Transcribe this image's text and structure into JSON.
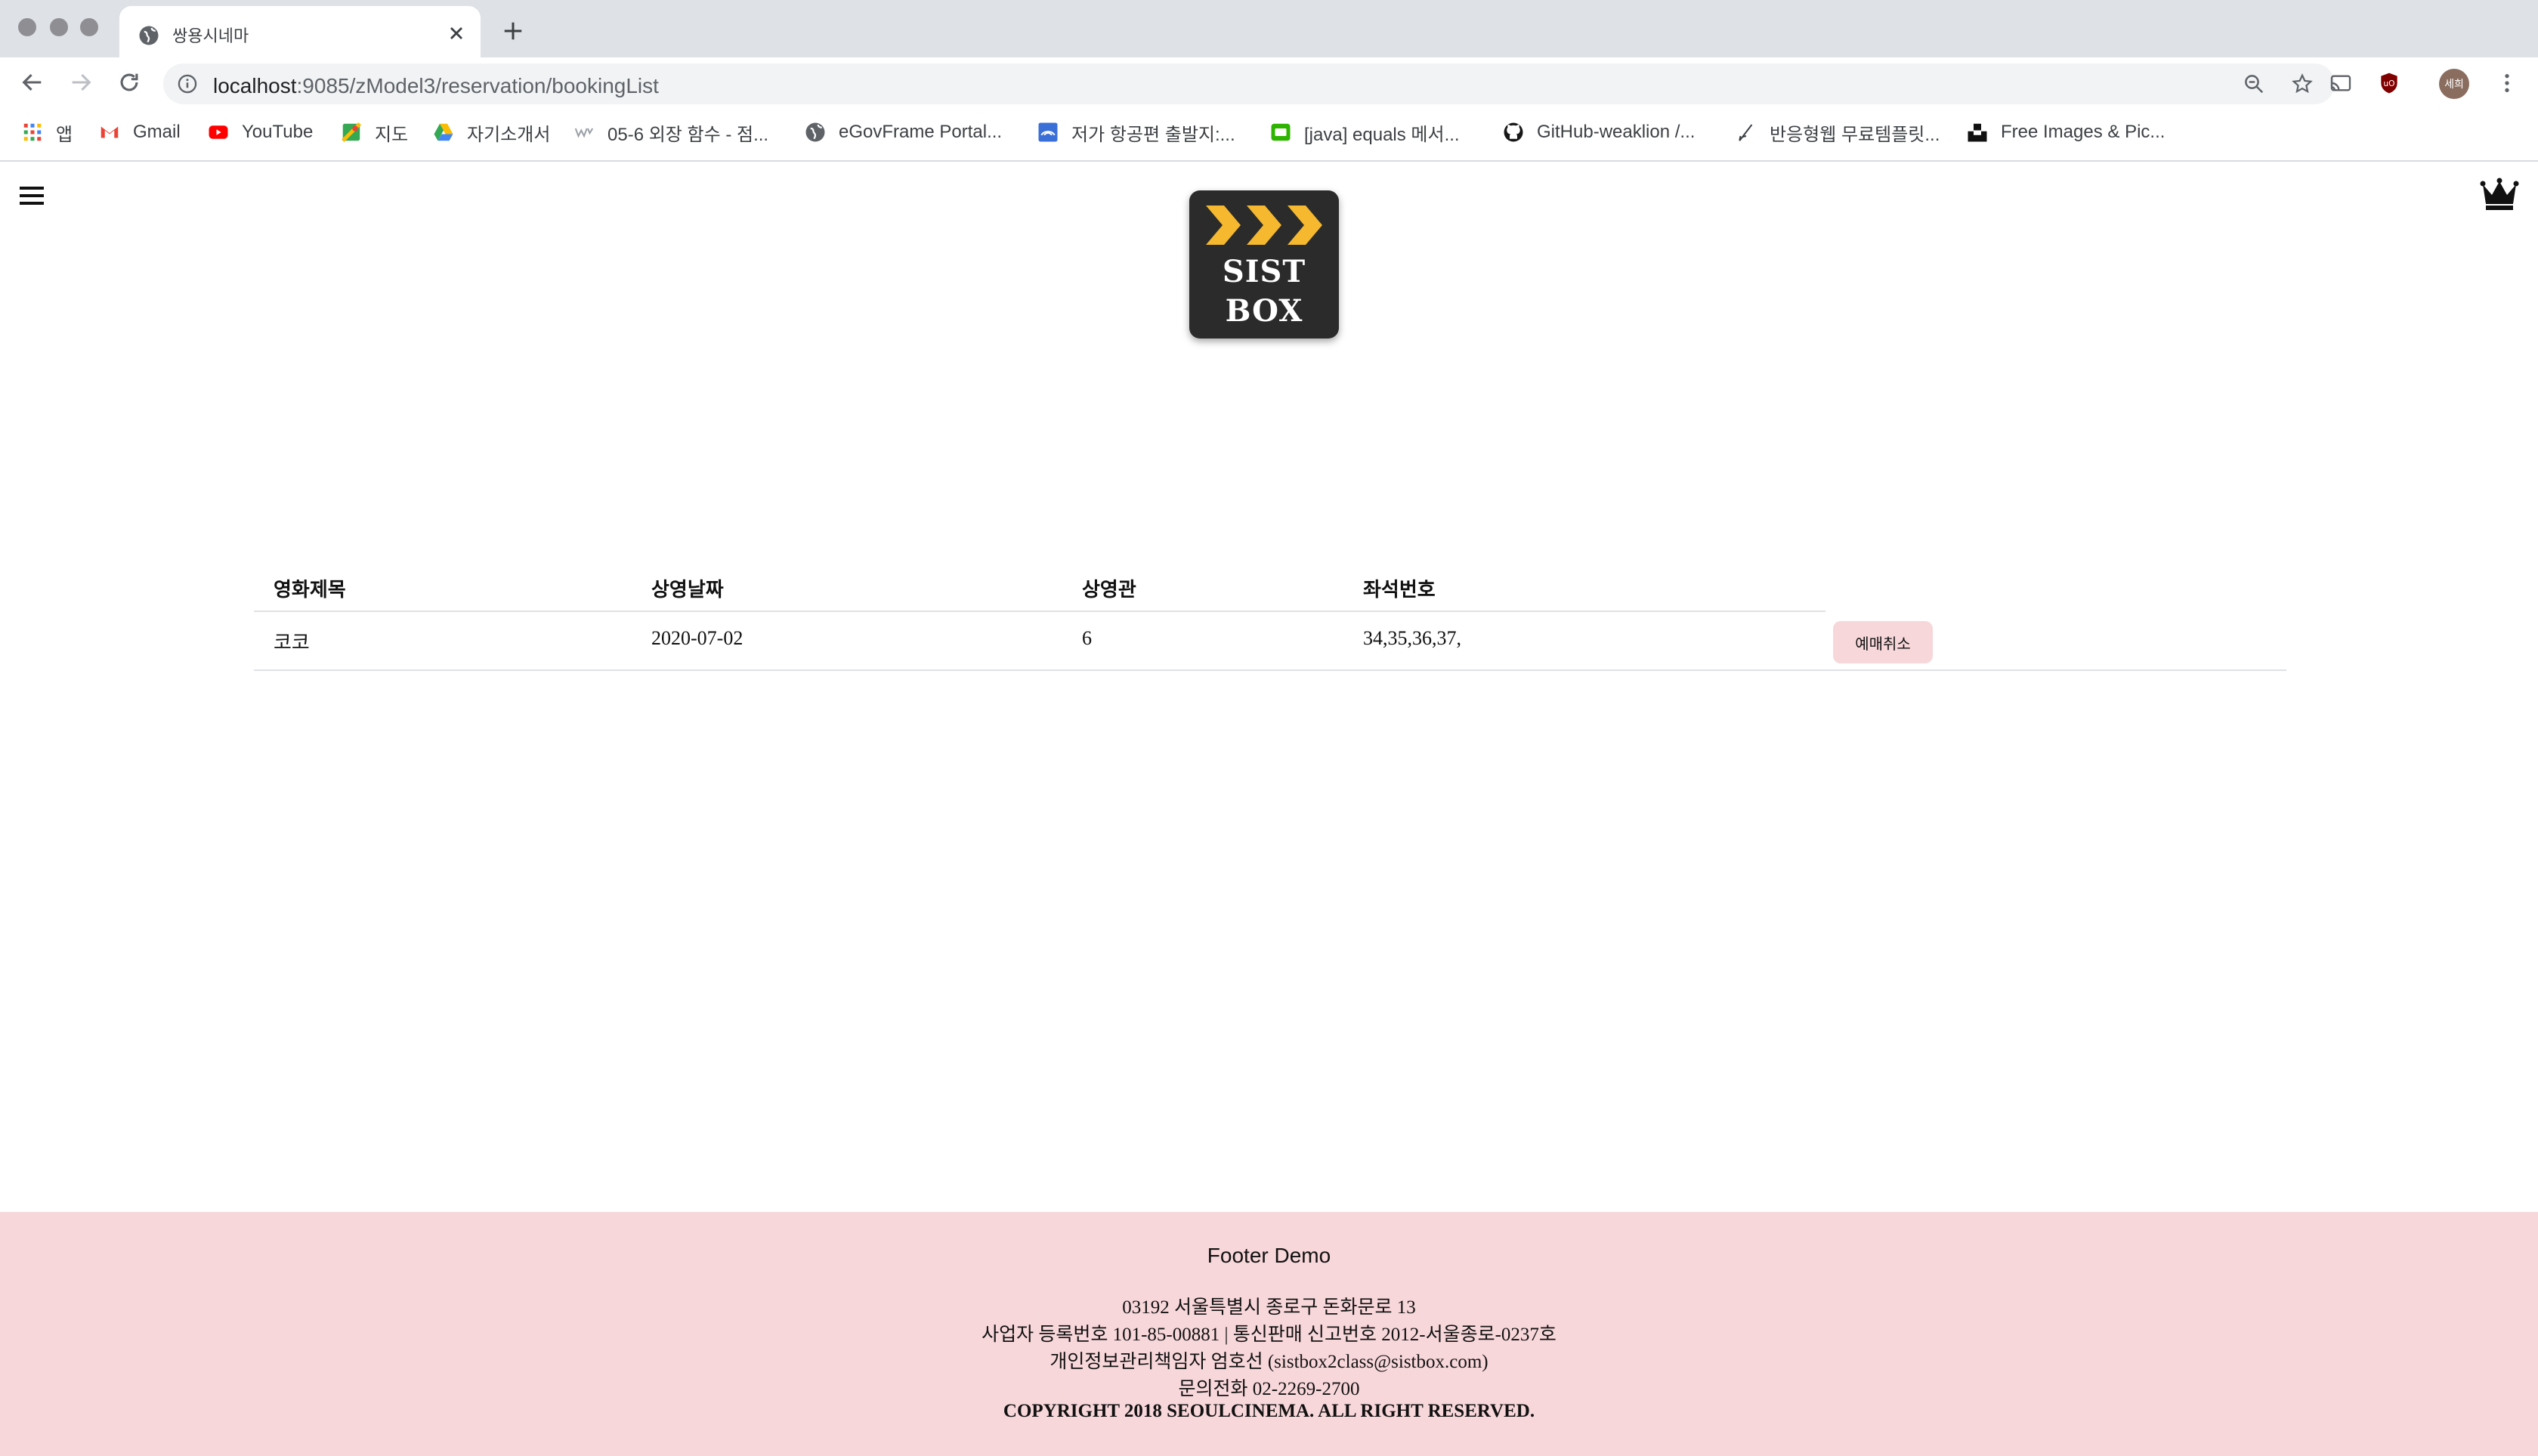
{
  "browser": {
    "tab_title": "쌍용시네마",
    "url_host": "localhost",
    "url_path": ":9085/zModel3/reservation/bookingList",
    "profile_label": "세희",
    "bookmarks": [
      {
        "label": "앱",
        "icon": "apps-grid-icon"
      },
      {
        "label": "Gmail",
        "icon": "gmail-icon"
      },
      {
        "label": "YouTube",
        "icon": "youtube-icon"
      },
      {
        "label": "지도",
        "icon": "maps-icon"
      },
      {
        "label": "자기소개서",
        "icon": "drive-icon"
      },
      {
        "label": "05-6 외장 함수 - 점...",
        "icon": "wikidocs-icon"
      },
      {
        "label": "eGovFrame Portal...",
        "icon": "globe-icon"
      },
      {
        "label": "저가 항공편 출발지:...",
        "icon": "flight-icon"
      },
      {
        "label": "[java] equals 메서...",
        "icon": "blog-icon"
      },
      {
        "label": "GitHub-weaklion /...",
        "icon": "github-icon"
      },
      {
        "label": "반응형웹 무료템플릿...",
        "icon": "pen-icon"
      },
      {
        "label": "Free Images & Pic...",
        "icon": "unsplash-icon"
      }
    ]
  },
  "header": {
    "logo_line1": "SIST",
    "logo_line2": "BOX",
    "logo_chevron_color": "#f5b82e"
  },
  "booking_table": {
    "columns": [
      "영화제목",
      "상영날짜",
      "상영관",
      "좌석번호"
    ],
    "rows": [
      {
        "title": "코코",
        "date": "2020-07-02",
        "hall": "6",
        "seats": "34,35,36,37,",
        "action": "예매취소"
      }
    ]
  },
  "footer": {
    "title": "Footer Demo",
    "address": "03192 서울특별시 종로구 돈화문로 13",
    "business": "사업자 등록번호 101-85-00881 | 통신판매 신고번호 2012-서울종로-0237호",
    "privacy": "개인정보관리책임자 엄호선 (sistbox2class@sistbox.com)",
    "phone": "문의전화 02-2269-2700",
    "copyright": "COPYRIGHT 2018 SEOULCINEMA. ALL RIGHT RESERVED.",
    "bg_color": "#f8d7da"
  }
}
